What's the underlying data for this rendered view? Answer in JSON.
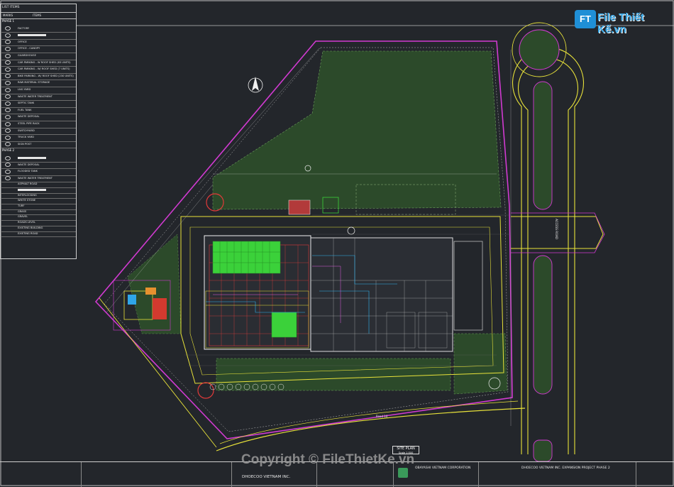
{
  "legend": {
    "header": "LIST ITEMS",
    "col_marks": "MARKS",
    "col_items": "ITEMS",
    "phase1": "PHASE 1",
    "phase2": "PHASE 2",
    "phase1_items": [
      "FACTORY",
      "",
      "OFFICE",
      "OFFICE - CANOPY",
      "GUARDHOUSE",
      "CAR PARKING - W ROOF SHED (63 UNITS)",
      "CAR PARKING - W/ ROOF SHED (7 UNITS)",
      "BIKE PARKING - W/ ROOF SHED (230 UNITS)",
      "RAW MATERIAL STORAGE",
      "LNG YARD",
      "WASTE WATER TREATMENT",
      "SEPTIC TANK",
      "FUEL TANK",
      "WASTE DEPOSAL",
      "STEEL PIPE RACK",
      "SWITCHYARD",
      "TRUCK YARD",
      "SIGN POST"
    ],
    "phase2_items": [
      "",
      "WASTE DEPOSAL",
      "FLOODED TANK",
      "WASTE WATER TREATMENT"
    ],
    "other_items": [
      "ASPHALT ROAD",
      "",
      "INTERLOCKING",
      "WHITE STONE",
      "TURF",
      "GRASS",
      "GRAVEL",
      "ROADS LEVEL",
      "EXISTING BUILDING",
      "EXISTING ROAD"
    ]
  },
  "plan": {
    "access_road": "ACCESS ROAD",
    "road_label": "Road 10",
    "site_plan_title": "SITE PLAN",
    "site_plan_scale": "Scale 1:500"
  },
  "title_block": {
    "client": "DHOECOO VIETNAM INC.",
    "consultant": "OBAYASHI VIETNAM CORPORATION",
    "project": "DHOECOO VIETNAM INC. EXPANSION PROJECT PHASE 2"
  },
  "watermark": {
    "logo_mark": "FT",
    "logo_text": "File Thiết Kế.vn",
    "copyright": "Copyright © FileThietKe.vn"
  },
  "colors": {
    "background": "#23262b",
    "field_green": "#2e4d2b",
    "magenta": "#d13ad1",
    "yellow": "#e8e23a",
    "red": "#e23a3a",
    "bright_green": "#3bd13a"
  }
}
